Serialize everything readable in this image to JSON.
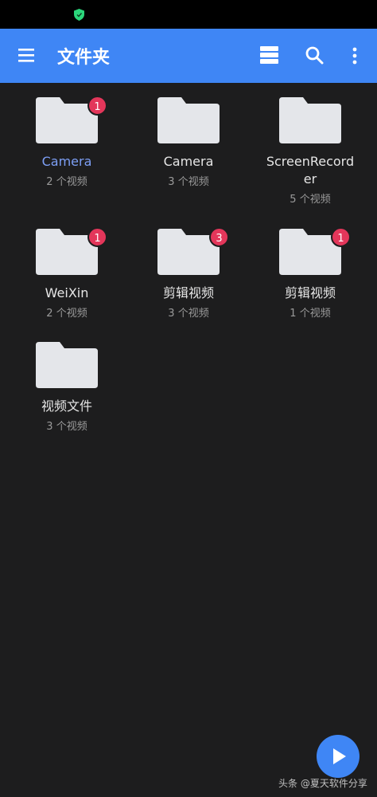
{
  "app_bar": {
    "title": "文件夹",
    "background_color": "#3f86f5",
    "icons": [
      "menu-icon",
      "view-toggle-icon",
      "search-icon",
      "more-vert-icon"
    ]
  },
  "folders": [
    {
      "name": "Camera",
      "count": "2 个视频",
      "badge": "1",
      "name_color": "#7d9ff5"
    },
    {
      "name": "Camera",
      "count": "3 个视频",
      "badge": ""
    },
    {
      "name": "ScreenRecorder",
      "count": "5 个视频",
      "badge": ""
    },
    {
      "name": "WeiXin",
      "count": "2 个视频",
      "badge": "1"
    },
    {
      "name": "剪辑视频",
      "count": "3 个视频",
      "badge": "3"
    },
    {
      "name": "剪辑视频",
      "count": "1 个视频",
      "badge": "1"
    },
    {
      "name": "视频文件",
      "count": "3 个视频",
      "badge": ""
    }
  ],
  "colors": {
    "background": "#1d1d1e",
    "folder": "#e4e6ea",
    "badge": "#e3365a",
    "fab": "#3f86f5"
  },
  "fab": {
    "icon": "play-icon"
  },
  "watermark": "头条 @夏天软件分享"
}
